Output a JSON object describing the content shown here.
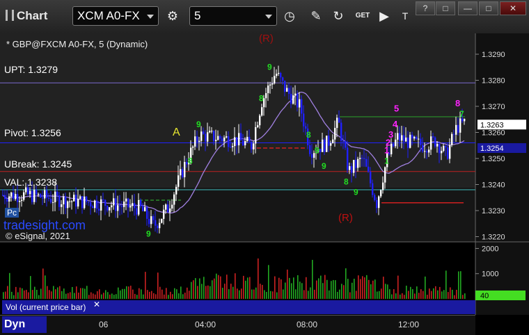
{
  "window": {
    "title": "Chart",
    "symbol": "XCM A0-FX",
    "interval": "5",
    "get_label": "GET",
    "win_buttons": [
      "?",
      "□",
      "—",
      "□",
      "✕"
    ]
  },
  "overlay": {
    "symbol_desc": "* GBP@FXCM A0-FX, 5 (Dynamic)",
    "upt": "UPT: 1.3279",
    "pivot": "Pivot: 1.3256",
    "ubreak": "UBreak: 1.3245",
    "val": "VAL: 1.3238",
    "marker_a": "A",
    "watermark": "tradesight.com",
    "copyright": "© eSignal, 2021",
    "pc_label": "Pc",
    "r_label": "(R)",
    "vol_label": "Vol (current price bar)",
    "dyn_label": "Dyn",
    "vol_value": "40"
  },
  "chart_data": {
    "type": "candlestick",
    "ylim": [
      1.3218,
      1.3298
    ],
    "yticks": [
      1.322,
      1.323,
      1.324,
      1.325,
      1.326,
      1.327,
      1.328,
      1.329
    ],
    "ytick_labels": [
      "1.3220",
      "1.3230",
      "1.3240",
      "1.3250",
      "1.3260",
      "1.3270",
      "1.3280",
      "1.3290"
    ],
    "price_tags": [
      {
        "label": "1.3263",
        "value": 1.3263,
        "color": "#ffffff",
        "text": "#000000"
      },
      {
        "label": "1.3254",
        "value": 1.3254,
        "color": "#1a1aa0",
        "text": "#ffffff"
      }
    ],
    "levels": [
      {
        "name": "UPT",
        "value": 1.3279,
        "color": "#7a6ad0"
      },
      {
        "name": "Pivot",
        "value": 1.3256,
        "color": "#2020ff"
      },
      {
        "name": "UBreak",
        "value": 1.3245,
        "color": "#c02020"
      },
      {
        "name": "VAL",
        "value": 1.3238,
        "color": "#40c0c0"
      }
    ],
    "volume": {
      "yticks": [
        1000,
        2000
      ],
      "ytick_labels": [
        "1000",
        "2000"
      ],
      "ylim": [
        0,
        2150
      ]
    },
    "x_labels": [
      "06",
      "04:00",
      "08:00",
      "12:00"
    ],
    "colors": {
      "up": "#ffffff",
      "down": "#2020ff",
      "ma": "#a080e0",
      "vol_up": "#22aa22",
      "vol_down": "#cc2222"
    }
  }
}
